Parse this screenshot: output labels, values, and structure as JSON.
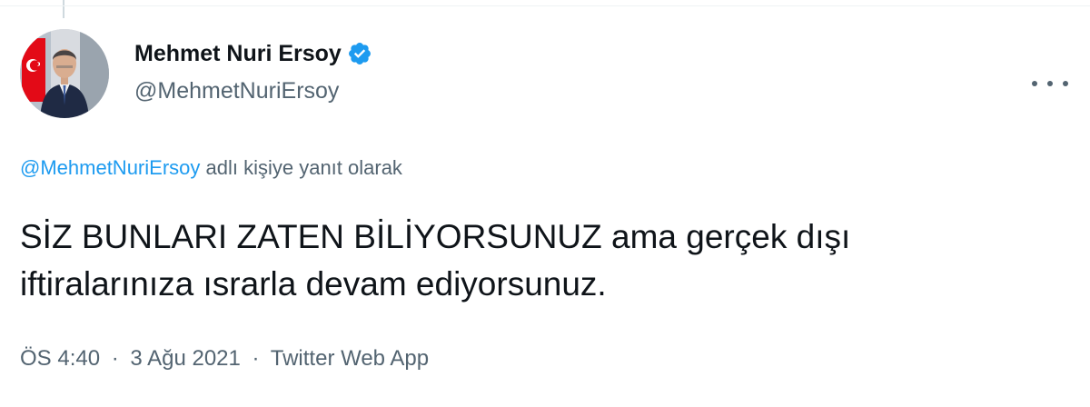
{
  "author": {
    "display_name": "Mehmet Nuri Ersoy",
    "handle": "@MehmetNuriErsoy",
    "verified": true,
    "avatar_icon": "profile-photo",
    "verified_icon": "verified-badge-icon"
  },
  "reply": {
    "mention": "@MehmetNuriErsoy",
    "suffix": " adlı kişiye yanıt olarak"
  },
  "tweet": {
    "text": "SİZ BUNLARI ZATEN BİLİYORSUNUZ ama gerçek dışı\niftiralarınıza ısrarla devam ediyorsunuz."
  },
  "meta": {
    "time": "ÖS 4:40",
    "separator": "·",
    "date": "3 Ağu 2021",
    "source": "Twitter Web App"
  },
  "colors": {
    "accent": "#1d9bf0",
    "secondary_text": "#536471",
    "primary_text": "#0f1419"
  }
}
